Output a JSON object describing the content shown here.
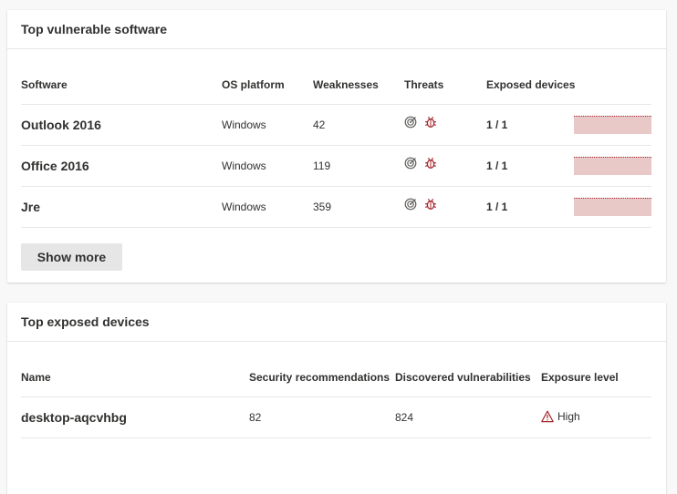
{
  "software_card": {
    "title": "Top vulnerable software",
    "columns": [
      "Software",
      "OS platform",
      "Weaknesses",
      "Threats",
      "Exposed devices"
    ],
    "rows": [
      {
        "name": "Outlook 2016",
        "os": "Windows",
        "weaknesses": "42",
        "exposed": "1 / 1",
        "exposed_fraction": 1.0
      },
      {
        "name": "Office 2016",
        "os": "Windows",
        "weaknesses": "119",
        "exposed": "1 / 1",
        "exposed_fraction": 1.0
      },
      {
        "name": "Jre",
        "os": "Windows",
        "weaknesses": "359",
        "exposed": "1 / 1",
        "exposed_fraction": 1.0
      }
    ],
    "threat_icons": [
      "exploit-target-icon",
      "bug-icon"
    ],
    "show_more_label": "Show more"
  },
  "devices_card": {
    "title": "Top exposed devices",
    "columns": [
      "Name",
      "Security recommendations",
      "Discovered vulnerabilities",
      "Exposure level"
    ],
    "rows": [
      {
        "name": "desktop-aqcvhbg",
        "recommendations": "82",
        "vulnerabilities": "824",
        "exposure_level": "High",
        "exposure_icon": "warning-icon"
      }
    ]
  },
  "colors": {
    "danger": "#a4262c",
    "bar_fill": "#e9c8c8",
    "button_bg": "#e6e6e6"
  }
}
